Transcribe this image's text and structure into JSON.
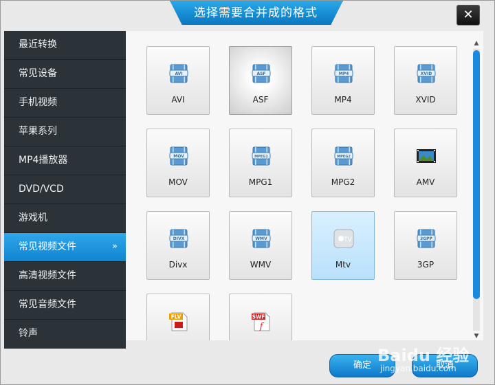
{
  "dialog": {
    "title": "选择需要合并成的格式",
    "close_label": "✕",
    "accent": "#1a8ae0"
  },
  "sidebar": {
    "items": [
      {
        "label": "最近转换"
      },
      {
        "label": "常见设备"
      },
      {
        "label": "手机视频"
      },
      {
        "label": "苹果系列"
      },
      {
        "label": "MP4播放器"
      },
      {
        "label": "DVD/VCD"
      },
      {
        "label": "游戏机"
      },
      {
        "label": "常见视频文件",
        "active": true,
        "chevron": "»"
      },
      {
        "label": "高清视频文件"
      },
      {
        "label": "常见音频文件"
      },
      {
        "label": "铃声"
      }
    ]
  },
  "formats": [
    {
      "label": "AVI",
      "badge": "AVI",
      "icon": "film-icon"
    },
    {
      "label": "ASF",
      "badge": "ASF",
      "icon": "film-icon",
      "state": "selected"
    },
    {
      "label": "MP4",
      "badge": "MP4",
      "icon": "film-icon"
    },
    {
      "label": "XVID",
      "badge": "XVID",
      "icon": "film-icon"
    },
    {
      "label": "MOV",
      "badge": "MOV",
      "icon": "film-icon"
    },
    {
      "label": "MPG1",
      "badge": "MPEG1",
      "icon": "film-icon"
    },
    {
      "label": "MPG2",
      "badge": "MPEG2",
      "icon": "film-icon"
    },
    {
      "label": "AMV",
      "badge": "",
      "icon": "film-strip-landscape-icon"
    },
    {
      "label": "Divx",
      "badge": "DIVX",
      "icon": "film-icon"
    },
    {
      "label": "WMV",
      "badge": "WMV",
      "icon": "film-icon"
    },
    {
      "label": "Mtv",
      "badge": "TV",
      "icon": "apple-tv-icon",
      "state": "hover"
    },
    {
      "label": "3GP",
      "badge": "3GPP",
      "icon": "film-icon"
    },
    {
      "label": "",
      "badge": "FLV",
      "icon": "flv-file-icon"
    },
    {
      "label": "",
      "badge": "SWF",
      "icon": "swf-file-icon"
    }
  ],
  "buttons": {
    "ok": "确定",
    "cancel": "取消"
  },
  "watermark": {
    "text": "Baidu 经验",
    "sub": "jingyan.baidu.com"
  }
}
